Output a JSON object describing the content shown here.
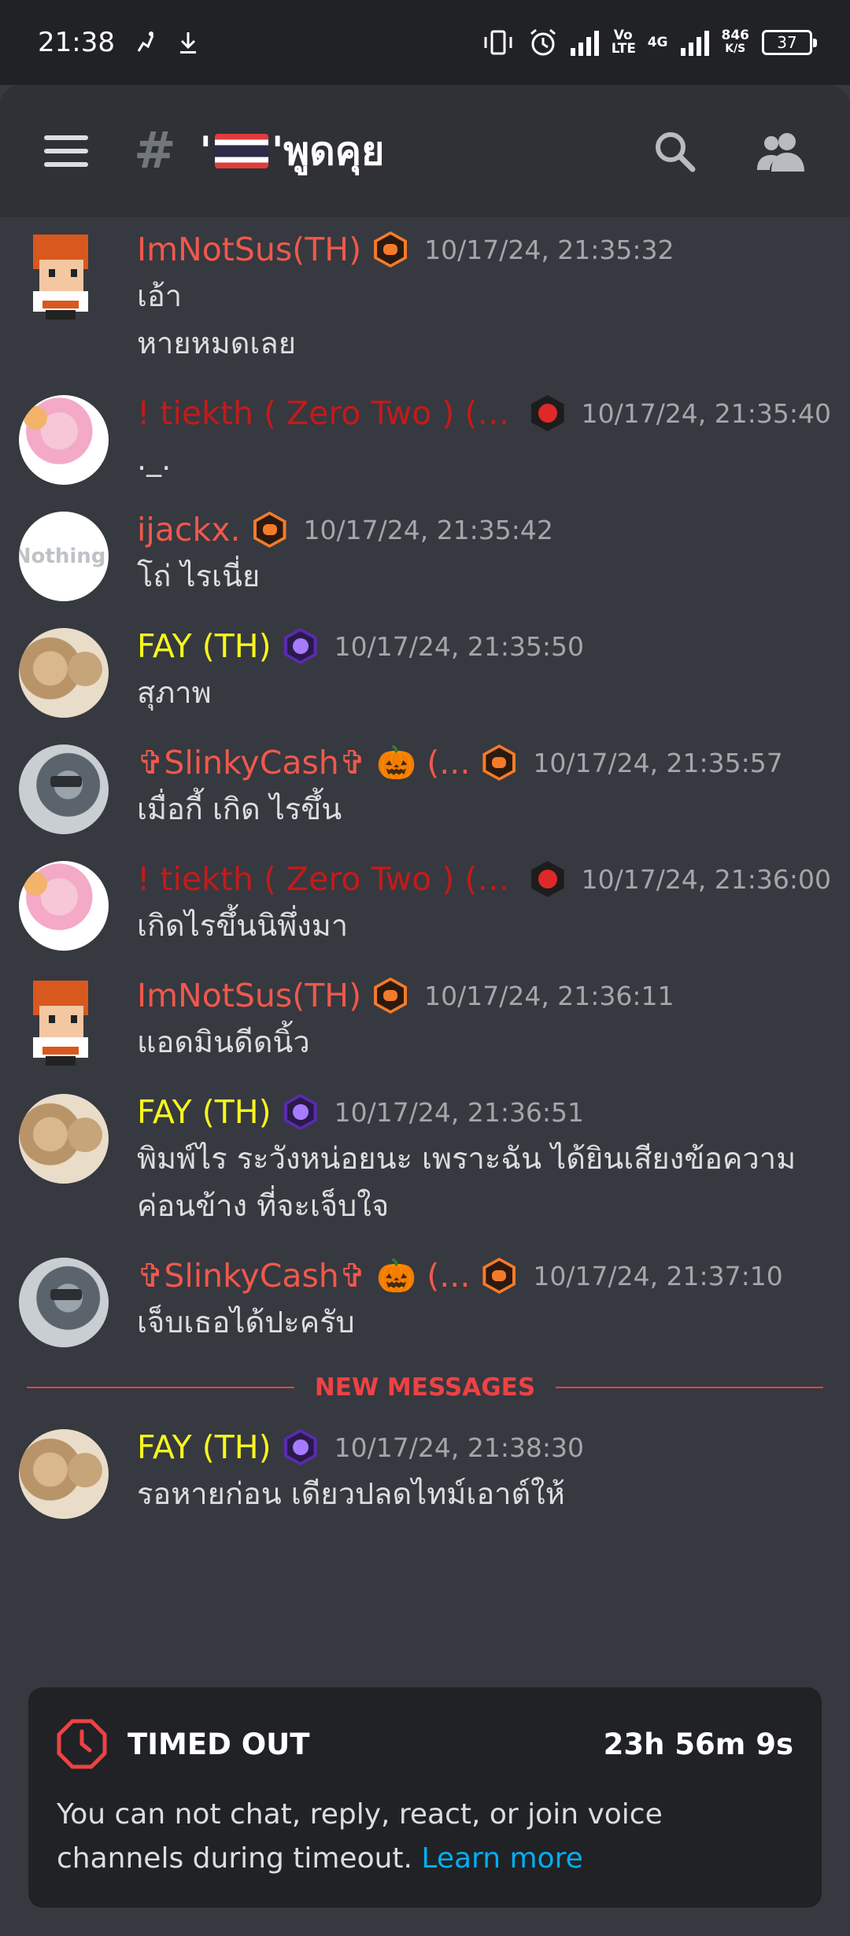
{
  "status_bar": {
    "time": "21:38",
    "volte": "Vo LTE",
    "net_4g": "4G",
    "speed_value": "846",
    "speed_unit": "K/S",
    "battery": "37"
  },
  "header": {
    "hash": "#",
    "channel_prefix": "'",
    "channel_middle": "'",
    "channel_name": "พูดคุย"
  },
  "messages": [
    {
      "username": "ImNotSus(TH)",
      "color": "#f0584c",
      "badge": "orange",
      "avatar": "pixel",
      "timestamp": "10/17/24, 21:35:32",
      "lines": [
        "เอ้า",
        "หายหมดเลย"
      ]
    },
    {
      "username": "! tiekth ( Zero Two ) (T...",
      "color": "#c41a1a",
      "badge": "red",
      "avatar": "anime",
      "timestamp": "10/17/24, 21:35:40",
      "lines": [
        "._."
      ]
    },
    {
      "username": "ijackx.",
      "color": "#f0584c",
      "badge": "orange",
      "avatar": "nothing",
      "avatar_text": "Nothing.",
      "timestamp": "10/17/24, 21:35:42",
      "lines": [
        "โถ่ ไรเนี่ย"
      ]
    },
    {
      "username": "FAY (TH)",
      "color": "#f7f71e",
      "badge": "purple",
      "avatar": "cat",
      "timestamp": "10/17/24, 21:35:50",
      "lines": [
        "สุภาพ"
      ]
    },
    {
      "username": "✞SlinkyCash✞ 🎃 (...",
      "color": "#f0584c",
      "badge": "orange",
      "avatar": "robot",
      "timestamp": "10/17/24, 21:35:57",
      "lines": [
        "เมื่อกี้ เกิด ไรขึ้น"
      ]
    },
    {
      "username": "! tiekth ( Zero Two ) (T...",
      "color": "#c41a1a",
      "badge": "red",
      "avatar": "anime",
      "timestamp": "10/17/24, 21:36:00",
      "lines": [
        "เกิดไรขึ้นนิพึ่งมา"
      ]
    },
    {
      "username": "ImNotSus(TH)",
      "color": "#f0584c",
      "badge": "orange",
      "avatar": "pixel",
      "timestamp": "10/17/24, 21:36:11",
      "lines": [
        "แอดมินดีดนิ้ว"
      ]
    },
    {
      "username": "FAY (TH)",
      "color": "#f7f71e",
      "badge": "purple",
      "avatar": "cat",
      "timestamp": "10/17/24, 21:36:51",
      "lines": [
        "พิมพ์ไร ระวังหน่อยนะ เพราะฉัน ได้ยินเสียงข้อความ",
        "ค่อนข้าง ที่จะเจ็บใจ"
      ]
    },
    {
      "username": "✞SlinkyCash✞ 🎃 (...",
      "color": "#f0584c",
      "badge": "orange",
      "avatar": "robot",
      "timestamp": "10/17/24, 21:37:10",
      "lines": [
        "เจ็บเธอได้ปะครับ"
      ]
    }
  ],
  "divider": {
    "label": "NEW MESSAGES"
  },
  "new_messages": [
    {
      "username": "FAY (TH)",
      "color": "#f7f71e",
      "badge": "purple",
      "avatar": "cat",
      "timestamp": "10/17/24, 21:38:30",
      "lines": [
        "รอหายก่อน เดียวปลดไทม์เอาต์ให้"
      ]
    }
  ],
  "timeout": {
    "title": "TIMED OUT",
    "timer": "23h 56m 9s",
    "body": "You can not chat, reply, react, or join voice channels during timeout.",
    "link": "Learn more",
    "accent": "#ed4245"
  }
}
